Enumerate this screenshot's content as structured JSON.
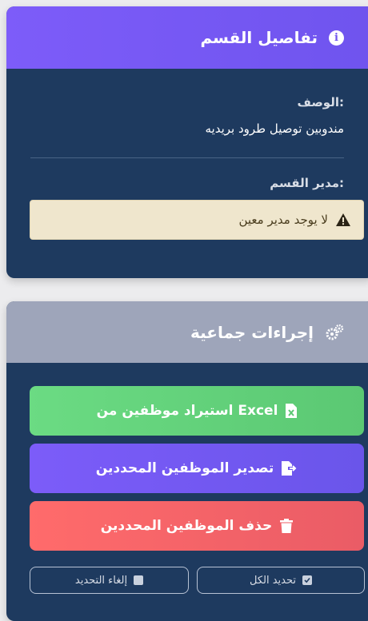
{
  "dept_card": {
    "title": "تفاصيل القسم",
    "header_icon": "info-circle-icon",
    "description_label": "الوصف:",
    "description_value": "مندوبين توصيل طرود بريديه",
    "manager_label": "مدير القسم:",
    "manager_alert": "لا يوجد مدير معين",
    "alert_icon": "warning-triangle-icon"
  },
  "bulk_card": {
    "title": "إجراءات جماعية",
    "header_icon": "cogs-icon",
    "import_label": "استيراد موظفين من Excel",
    "export_label": "تصدير الموظفين المحددين",
    "delete_label": "حذف الموظفين المحددين",
    "select_all_label": "تحديد الكل",
    "deselect_label": "إلغاء التحديد"
  },
  "colors": {
    "purple": "#6f54ee",
    "navy": "#1e3a5f",
    "green": "#5bc873",
    "red": "#ea5c66",
    "gray_header": "#9ea5ba"
  }
}
